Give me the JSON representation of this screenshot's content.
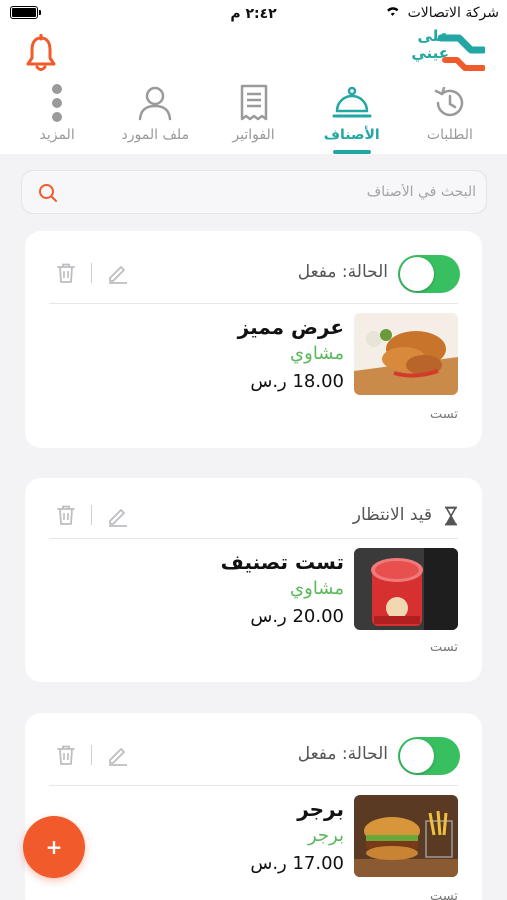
{
  "status_bar": {
    "carrier": "شركة الاتصالات",
    "time": "٢:٤٢ م"
  },
  "header": {
    "logo_text": "على عيني"
  },
  "tabs": [
    {
      "label": "الطلبات",
      "icon": "history-icon",
      "active": false
    },
    {
      "label": "الأصناف",
      "icon": "cloche-icon",
      "active": true
    },
    {
      "label": "الفواتير",
      "icon": "receipt-icon",
      "active": false
    },
    {
      "label": "ملف المورد",
      "icon": "user-icon",
      "active": false
    },
    {
      "label": "المزيد",
      "icon": "more-vertical-icon",
      "active": false
    }
  ],
  "search": {
    "placeholder": "البحث في الأصناف",
    "value": ""
  },
  "items": [
    {
      "status": "الحالة: مفعل",
      "status_type": "enabled",
      "toggle_on": true,
      "name": "عرض مميز",
      "category": "مشاوي",
      "price": "18.00 ر.س",
      "note": "تست",
      "image": "fried-chicken-image"
    },
    {
      "status": "قيد الانتظار",
      "status_type": "pending",
      "toggle_on": false,
      "name": "تست تصنيف",
      "category": "مشاوي",
      "price": "20.00 ر.س",
      "note": "تست",
      "image": "chips-can-image"
    },
    {
      "status": "الحالة: مفعل",
      "status_type": "enabled",
      "toggle_on": true,
      "name": "برجر",
      "category": "برجر",
      "price": "17.00 ر.س",
      "note": "تست",
      "image": "burger-image"
    }
  ],
  "fab": {
    "label": "+"
  },
  "colors": {
    "brand": "#22a7a4",
    "accent": "#f15a2b",
    "enabled": "#38c060",
    "category": "#5cb85c"
  }
}
